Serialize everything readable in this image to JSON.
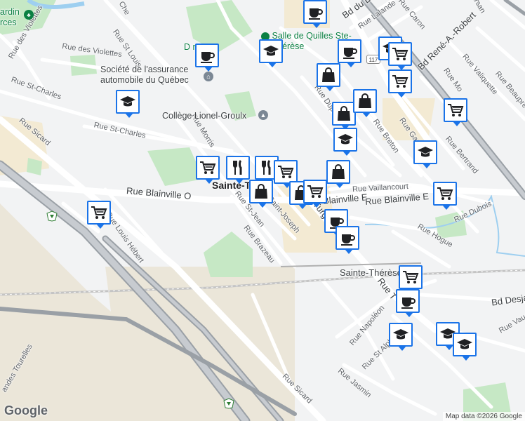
{
  "map": {
    "colors": {
      "background": "#f2f3f4",
      "park": "#c6e8c5",
      "commercial": "#f3ead3",
      "industrial": "#ebe6d9",
      "highway": "#9aa0a6",
      "road": "#ffffff",
      "water": "#9ecff0",
      "rail": "#c4c4c4",
      "marker_border": "#1a73e8"
    },
    "labels": {
      "rue_st_louis": "Rue St Louis",
      "rue_des_violettes_1": "Rue des Violettes",
      "rue_des_violettes_2": "Rue des Violettes",
      "rue_st_charles_1": "Rue St-Charles",
      "rue_st_charles_2": "Rue St-Charles",
      "rue_sicard_1": "Rue Sicard",
      "rue_sicard_2": "Rue Sicard",
      "rue_morris": "Rue Morris",
      "rue_blainville_o": "Rue Blainville O",
      "rue_blainville_e_1": "Blainville E",
      "rue_blainville_e_2": "Rue Blainville E",
      "rue_louis_hebert": "Rue Louis Hébert",
      "rue_st_jean": "Rue St-Jean",
      "rue_saint_joseph": "Saint-Joseph",
      "rue_brazeau": "Rue Brazeau",
      "rue_turgeon": "Turgeon",
      "rue_vaillancourt": "Rue Vaillancourt",
      "rue_breton": "Rue Breton",
      "rue_dupuis": "Rue Dupuis",
      "rue_gauthier": "Rue Gauth",
      "rue_bertrand": "Rue Bertrand",
      "rue_dubois": "Rue Dubois",
      "rue_hogue": "Rue Hogue",
      "rue_lalande": "Rue Lalande",
      "rue_caron": "Rue Caron",
      "rue_valiquette": "Rue Valiquette",
      "rue_beaupre": "Rue Beaupré",
      "rue_napoleon": "Rue Napoléon",
      "rue_st_alphonse": "Rue St Alphonse",
      "rue_jasmin": "Rue Jasmin",
      "rue_vaudry": "Rue Vaudry",
      "rue_t": "Rue T",
      "rue_che": "Che",
      "rue_mo": "Rue Mo",
      "rue_arsan": "arsan",
      "rue_bd_dor": "Bd du Do",
      "bd_rene_robert": "Bd René-A.-Robert",
      "bd_desja": "Bd Desja",
      "grandes_tourelles": "andes Tourelles",
      "station_label": "Sainte-Thérèse",
      "city_label": "Sainte-Th",
      "salle_de_quilles": "Salle de Quilles Ste-Thérèse",
      "societe_assurance": "Société de l'assurance automobile du Québec",
      "college_lionel": "Collège Lionel-Groulx",
      "jardin": "ardin rces",
      "duval_park": "D         ne",
      "route_117": "117"
    },
    "markers": [
      {
        "id": "cafe-1",
        "type": "cafe",
        "icon": "coffee-cup-icon"
      },
      {
        "id": "school-1",
        "type": "school",
        "icon": "graduation-cap-icon"
      },
      {
        "id": "cafe-2",
        "type": "cafe",
        "icon": "coffee-cup-icon"
      },
      {
        "id": "school-2",
        "type": "school",
        "icon": "graduation-cap-icon"
      },
      {
        "id": "grocery-1",
        "type": "grocery",
        "icon": "shopping-cart-icon"
      },
      {
        "id": "school-3",
        "type": "school",
        "icon": "graduation-cap-icon"
      },
      {
        "id": "cafe-3",
        "type": "cafe",
        "icon": "coffee-cup-icon"
      },
      {
        "id": "shop-1",
        "type": "store",
        "icon": "shopping-bag-icon"
      },
      {
        "id": "grocery-2",
        "type": "grocery",
        "icon": "shopping-cart-icon"
      },
      {
        "id": "shop-2",
        "type": "store",
        "icon": "shopping-bag-icon"
      },
      {
        "id": "shop-3",
        "type": "store",
        "icon": "shopping-bag-icon"
      },
      {
        "id": "grocery-3",
        "type": "grocery",
        "icon": "shopping-cart-icon"
      },
      {
        "id": "school-4",
        "type": "school",
        "icon": "graduation-cap-icon"
      },
      {
        "id": "school-5",
        "type": "school",
        "icon": "graduation-cap-icon"
      },
      {
        "id": "grocery-4",
        "type": "grocery",
        "icon": "shopping-cart-icon"
      },
      {
        "id": "restaurant-1",
        "type": "restaurant",
        "icon": "fork-knife-icon"
      },
      {
        "id": "restaurant-2",
        "type": "restaurant",
        "icon": "fork-knife-icon"
      },
      {
        "id": "grocery-5",
        "type": "grocery",
        "icon": "shopping-cart-icon"
      },
      {
        "id": "shop-4",
        "type": "store",
        "icon": "shopping-bag-icon"
      },
      {
        "id": "shop-5",
        "type": "store",
        "icon": "shopping-bag-icon"
      },
      {
        "id": "shop-6",
        "type": "store",
        "icon": "shopping-bag-icon"
      },
      {
        "id": "grocery-6",
        "type": "grocery",
        "icon": "shopping-cart-icon"
      },
      {
        "id": "grocery-7",
        "type": "grocery",
        "icon": "shopping-cart-icon"
      },
      {
        "id": "grocery-8",
        "type": "grocery",
        "icon": "shopping-cart-icon"
      },
      {
        "id": "cafe-4",
        "type": "cafe",
        "icon": "coffee-cup-icon"
      },
      {
        "id": "cafe-5",
        "type": "cafe",
        "icon": "coffee-cup-icon"
      },
      {
        "id": "grocery-9",
        "type": "grocery",
        "icon": "shopping-cart-icon"
      },
      {
        "id": "cafe-6",
        "type": "cafe",
        "icon": "coffee-cup-icon"
      },
      {
        "id": "school-6",
        "type": "school",
        "icon": "graduation-cap-icon"
      },
      {
        "id": "school-7",
        "type": "school",
        "icon": "graduation-cap-icon"
      },
      {
        "id": "school-8",
        "type": "school",
        "icon": "graduation-cap-icon"
      }
    ],
    "footer": {
      "logo": "Google",
      "attribution": "Map data ©2026 Google"
    }
  }
}
